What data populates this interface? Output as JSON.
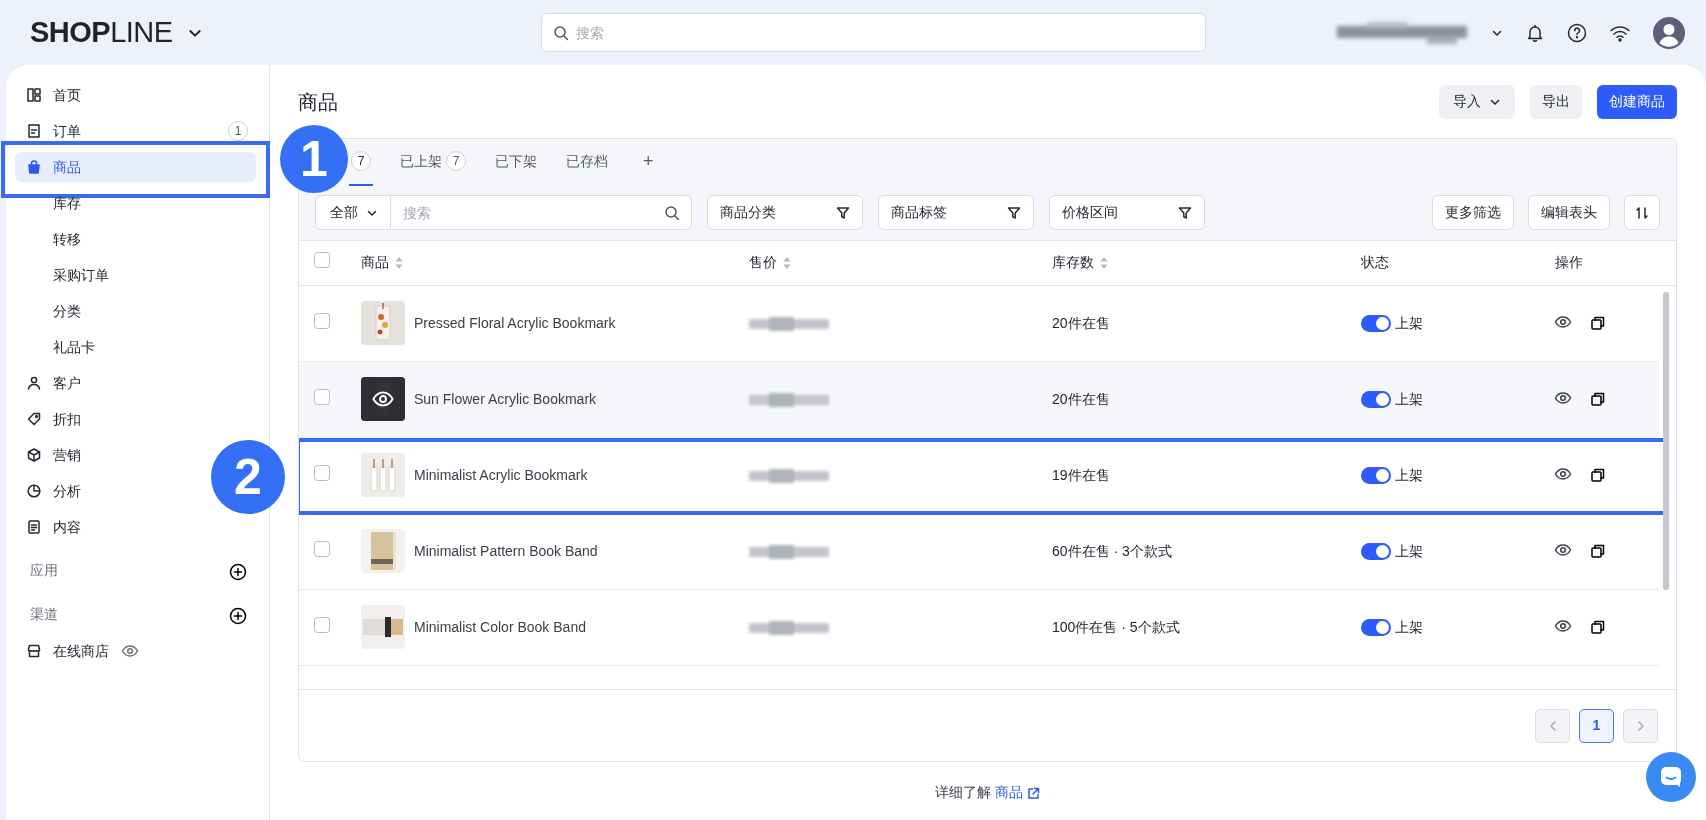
{
  "header": {
    "logo": "**SHOP**LINE",
    "search": {
      "placeholder": "搜索"
    }
  },
  "sidebar": {
    "items": [
      {
        "label": "首页",
        "selected": false
      },
      {
        "label": "订单",
        "selected": false,
        "count": "1"
      },
      {
        "label": "商品",
        "selected": true,
        "highlighted": true,
        "children": [
          {
            "label": "库存",
            "selected": false
          },
          {
            "label": "转移",
            "selected": false
          },
          {
            "label": "采购订单",
            "selected": false
          },
          {
            "label": "分类",
            "selected": false
          },
          {
            "label": "礼品卡",
            "selected": false
          }
        ]
      },
      {
        "label": "客户",
        "selected": false
      },
      {
        "label": "折扣",
        "selected": false
      },
      {
        "label": "营销",
        "selected": false
      },
      {
        "label": "分析",
        "selected": false
      },
      {
        "label": "内容",
        "selected": false
      }
    ],
    "sections": [
      {
        "label": "应用"
      },
      {
        "label": "渠道",
        "items": [
          {
            "label": "在线商店"
          }
        ]
      }
    ]
  },
  "page": {
    "title": "商品",
    "buttons": [
      {
        "label": "导入",
        "kind": "dropdown"
      },
      {
        "label": "导出",
        "kind": "secondary"
      },
      {
        "label": "创建商品",
        "kind": "primary"
      }
    ]
  },
  "tabs": [
    {
      "count": "7",
      "selected": true
    },
    {
      "label": "已上架",
      "count": "7",
      "selected": false
    },
    {
      "label": "已下架",
      "selected": false
    },
    {
      "label": "已存档",
      "selected": false
    },
    {
      "label": "+",
      "selected": false
    }
  ],
  "filters": {
    "scope": "全部",
    "search": {
      "placeholder": "搜索"
    },
    "dropdowns": [
      "商品分类",
      "商品标签",
      "价格区间"
    ],
    "buttons": [
      "更多筛选",
      "编辑表头"
    ]
  },
  "table": {
    "columns": [
      {
        "label": "商品",
        "sortable": true
      },
      {
        "label": "售价",
        "sortable": true
      },
      {
        "label": "库存数",
        "sortable": true
      },
      {
        "label": "状态"
      },
      {
        "label": "操作"
      }
    ],
    "select_all_checked": false,
    "rows": [
      {
        "name": "Pressed Floral Acrylic Bookmark",
        "stock": "20件在售",
        "status": "上架",
        "on": true,
        "checked": false,
        "hovered": false,
        "highlighted": false
      },
      {
        "name": "Sun Flower Acrylic Bookmark",
        "stock": "20件在售",
        "status": "上架",
        "on": true,
        "checked": false,
        "hovered": true,
        "highlighted": false
      },
      {
        "name": "Minimalist Acrylic Bookmark",
        "stock": "19件在售",
        "status": "上架",
        "on": true,
        "checked": false,
        "hovered": false,
        "highlighted": true
      },
      {
        "name": "Minimalist Pattern Book Band",
        "stock": "60件在售 · 3个款式",
        "status": "上架",
        "on": true,
        "checked": false,
        "hovered": false,
        "highlighted": false
      },
      {
        "name": "Minimalist Color Book Band",
        "stock": "100件在售 · 5个款式",
        "status": "上架",
        "on": true,
        "checked": false,
        "hovered": false,
        "highlighted": false
      }
    ]
  },
  "pagination": {
    "prev_disabled": true,
    "pages": [
      {
        "label": "1",
        "selected": true
      }
    ],
    "next_disabled": true
  },
  "footer": {
    "text": "详细了解",
    "link": "商品"
  },
  "annotations": [
    {
      "label": "1"
    },
    {
      "label": "2"
    }
  ]
}
